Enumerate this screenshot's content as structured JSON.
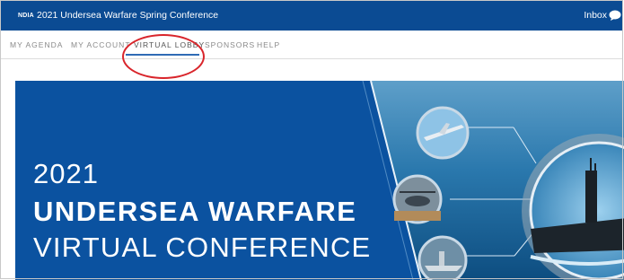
{
  "header": {
    "logo": "NDIA",
    "title": "2021 Undersea Warfare Spring Conference",
    "inbox_label": "Inbox"
  },
  "nav": {
    "items": [
      {
        "label": "MY AGENDA"
      },
      {
        "label": "MY ACCOUNT"
      },
      {
        "label": "VIRTUAL LOBBY",
        "active": true
      },
      {
        "label": "SPONSORS"
      },
      {
        "label": "HELP"
      }
    ]
  },
  "banner": {
    "year": "2021",
    "headline": "UNDERSEA WARFARE",
    "subline": "VIRTUAL CONFERENCE"
  },
  "colors": {
    "topbar": "#0b4b93",
    "banner_blue": "#0b52a0",
    "annotation_red": "#d9252b",
    "active_underline": "#2f6bb5"
  }
}
